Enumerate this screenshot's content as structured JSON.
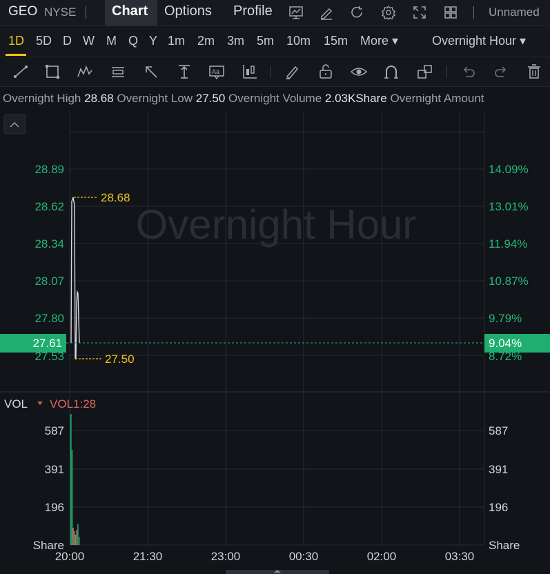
{
  "header": {
    "symbol": "GEO",
    "exchange": "NYSE",
    "tabs": [
      {
        "label": "Chart",
        "active": true
      },
      {
        "label": "Options"
      },
      {
        "label": "Profile"
      }
    ],
    "icons": [
      "line-chart-icon",
      "pencil-chart-icon",
      "refresh-icon",
      "gear-icon",
      "fullscreen-icon",
      "layout-grid-icon"
    ],
    "layout_name": "Unnamed"
  },
  "timeframes": {
    "items": [
      "1D",
      "5D",
      "D",
      "W",
      "M",
      "Q",
      "Y",
      "1m",
      "2m",
      "3m",
      "5m",
      "10m",
      "15m"
    ],
    "selected": "1D",
    "more_label": "More ▾",
    "session_label": "Overnight Hour ▾"
  },
  "tools": [
    "trend-line-icon",
    "rectangle-icon",
    "pattern-icon",
    "text-note-icon",
    "arrow-icon",
    "measure-icon",
    "text-label-icon",
    "candle-icon",
    "brush-icon",
    "lock-icon",
    "eye-icon",
    "magnet-icon",
    "clone-icon",
    "undo-icon",
    "redo-icon",
    "trash-icon"
  ],
  "stats": {
    "high_label": "Overnight High",
    "high_value": "28.68",
    "low_label": "Overnight Low",
    "low_value": "27.50",
    "volume_label": "Overnight Volume",
    "volume_value": "2.03KShare",
    "amount_label": "Overnight Amount"
  },
  "main": {
    "watermark": "Overnight Hour",
    "price_axis": [
      "28.89",
      "28.62",
      "28.34",
      "28.07",
      "27.80",
      "27.53"
    ],
    "pct_axis": [
      "14.09%",
      "13.01%",
      "11.94%",
      "10.87%",
      "9.79%",
      "8.72%"
    ],
    "current_price": "27.61",
    "current_pct": "9.04%",
    "high_marker": "28.68",
    "low_marker": "27.50"
  },
  "volume": {
    "label": "VOL",
    "indicator": "VOL1:28",
    "axis": [
      "587",
      "391",
      "196",
      "Share"
    ]
  },
  "time_axis": [
    "20:00",
    "21:30",
    "23:00",
    "00:30",
    "02:00",
    "03:30"
  ],
  "colors": {
    "up": "#25b877",
    "down": "#e2685a",
    "accent": "#f2c418"
  }
}
